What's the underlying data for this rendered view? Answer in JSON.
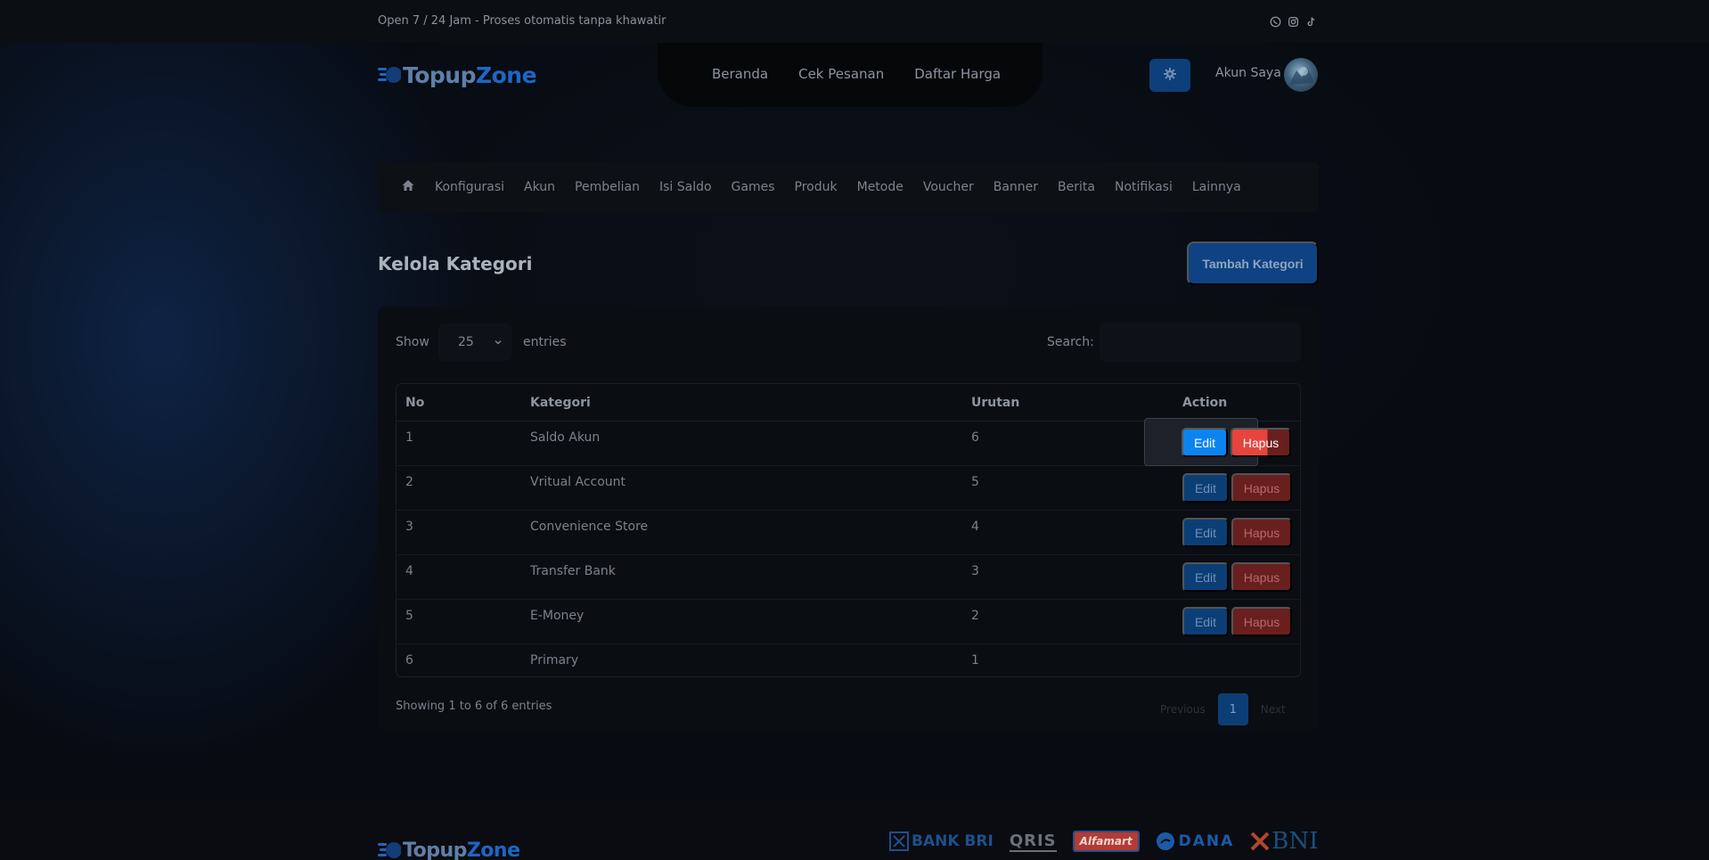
{
  "topbar": {
    "tagline": "Open 7 / 24 Jam - Proses otomatis tanpa khawatir",
    "socials": [
      "whatsapp-icon",
      "instagram-icon",
      "tiktok-icon"
    ]
  },
  "brand": {
    "part1": "Topup",
    "part2": "Zone"
  },
  "nav": {
    "home": "Beranda",
    "check": "Cek Pesanan",
    "prices": "Daftar Harga"
  },
  "account": {
    "label": "Akun Saya"
  },
  "admin_menu": [
    "Konfigurasi",
    "Akun",
    "Pembelian",
    "Isi Saldo",
    "Games",
    "Produk",
    "Metode",
    "Voucher",
    "Banner",
    "Berita",
    "Notifikasi",
    "Lainnya"
  ],
  "page": {
    "title": "Kelola Kategori",
    "add_button": "Tambah Kategori"
  },
  "table_controls": {
    "show_label": "Show",
    "page_length": "25",
    "entries_label": "entries",
    "search_label": "Search:",
    "search_value": ""
  },
  "table": {
    "headers": {
      "no": "No",
      "kategori": "Kategori",
      "urutan": "Urutan",
      "action": "Action"
    },
    "rows": [
      {
        "no": "1",
        "kategori": "Saldo Akun",
        "urutan": "6",
        "edit": "Edit",
        "delete": "Hapus"
      },
      {
        "no": "2",
        "kategori": "Vritual Account",
        "urutan": "5",
        "edit": "Edit",
        "delete": "Hapus"
      },
      {
        "no": "3",
        "kategori": "Convenience Store",
        "urutan": "4",
        "edit": "Edit",
        "delete": "Hapus"
      },
      {
        "no": "4",
        "kategori": "Transfer Bank",
        "urutan": "3",
        "edit": "Edit",
        "delete": "Hapus"
      },
      {
        "no": "5",
        "kategori": "E-Money",
        "urutan": "2",
        "edit": "Edit",
        "delete": "Hapus"
      },
      {
        "no": "6",
        "kategori": "Primary",
        "urutan": "1"
      }
    ]
  },
  "pagination": {
    "info": "Showing 1 to 6 of 6 entries",
    "prev": "Previous",
    "current": "1",
    "next": "Next"
  },
  "footer": {
    "partners": {
      "bri": "BANK BRI",
      "qris": "QRIS",
      "alfamart": "Alfamart",
      "dana": "DANA",
      "bni": "BNI"
    }
  },
  "colors": {
    "accent_blue": "#0b84f0",
    "danger_red": "#e5453d",
    "brand_blue": "#1f66c4"
  }
}
